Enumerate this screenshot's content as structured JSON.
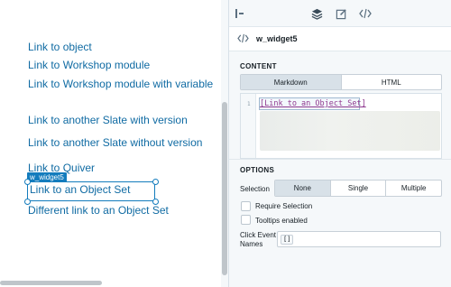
{
  "canvas": {
    "links": [
      "Link to object",
      "Link to Workshop module",
      "Link to Workshop module with variable",
      "Link to another Slate with version",
      "Link to another Slate without version",
      "Link to Quiver",
      "Link to an Object Set",
      "Different link to an Object Set"
    ],
    "selection_tag": "w_widget5"
  },
  "toolbar": {
    "icons": [
      "panel-collapse-icon",
      "layers-icon",
      "edit-icon",
      "code-icon"
    ]
  },
  "widget_header": {
    "name": "w_widget5"
  },
  "content": {
    "title": "CONTENT",
    "tabs": [
      "Markdown",
      "HTML"
    ],
    "active_tab": "Markdown",
    "line_number": "1",
    "code": "[Link to an Object Set]"
  },
  "options": {
    "title": "OPTIONS",
    "selection_label": "Selection",
    "selection_options": [
      "None",
      "Single",
      "Multiple"
    ],
    "selection_value": "None",
    "require_selection": "Require Selection",
    "tooltips_enabled": "Tooltips enabled",
    "click_events_label": "Click Event Names",
    "click_events_value": "[]"
  },
  "colors": {
    "link": "#106ba3",
    "selection": "#137cbd",
    "active_segment": "#d8e1e8"
  }
}
